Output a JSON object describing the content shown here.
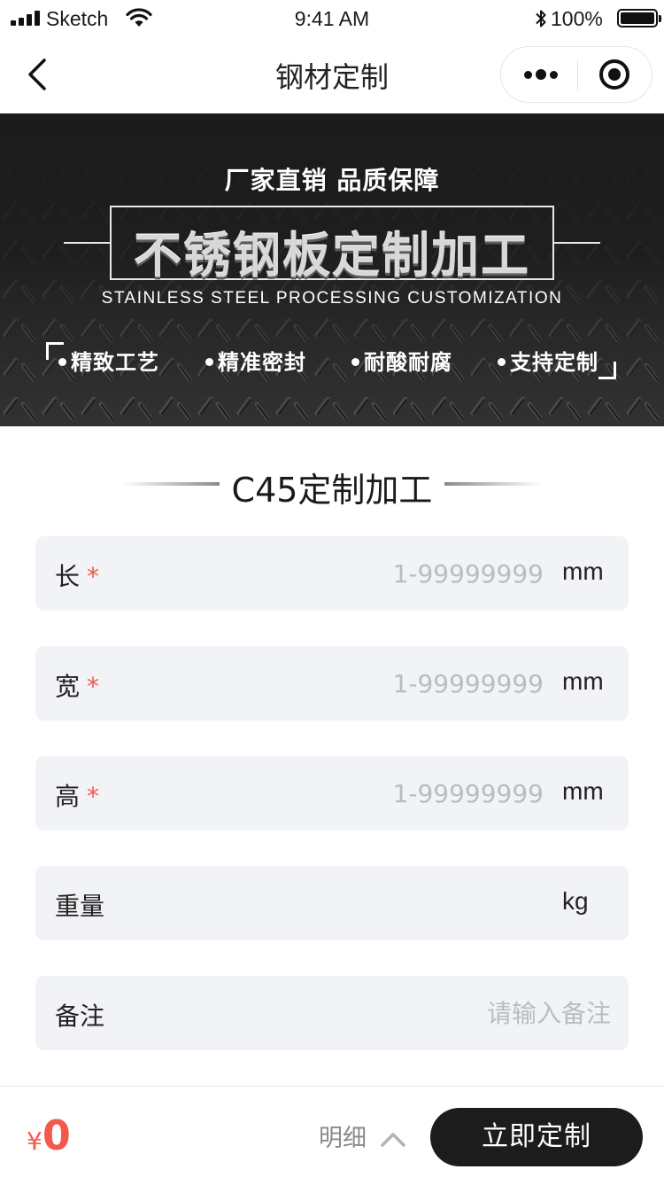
{
  "status_bar": {
    "carrier": "Sketch",
    "time": "9:41 AM",
    "battery": "100%"
  },
  "nav": {
    "title": "钢材定制"
  },
  "banner": {
    "tagline": "厂家直销  品质保障",
    "title": "不锈钢板定制加工",
    "subtitle": "STAINLESS STEEL PROCESSING CUSTOMIZATION",
    "features": [
      "精致工艺",
      "精准密封",
      "耐酸耐腐",
      "支持定制"
    ]
  },
  "section": {
    "title": "C45定制加工"
  },
  "form": {
    "fields": [
      {
        "label": "长",
        "required": "*",
        "placeholder": "1-99999999",
        "value": "",
        "unit": "mm"
      },
      {
        "label": "宽",
        "required": "*",
        "placeholder": "1-99999999",
        "value": "",
        "unit": "mm"
      },
      {
        "label": "高",
        "required": "*",
        "placeholder": "1-99999999",
        "value": "",
        "unit": "mm"
      },
      {
        "label": "重量",
        "placeholder": "",
        "value": "",
        "unit": "kg"
      },
      {
        "label": "备注",
        "placeholder": "请输入备注",
        "value": ""
      }
    ]
  },
  "bottom": {
    "currency": "¥",
    "price": "0",
    "detail_label": "明细",
    "submit_label": "立即定制"
  },
  "colors": {
    "accent": "#f15a4a",
    "button_bg": "#1c1c1c",
    "field_bg": "#f1f3f6",
    "placeholder": "#b9bdc3"
  }
}
